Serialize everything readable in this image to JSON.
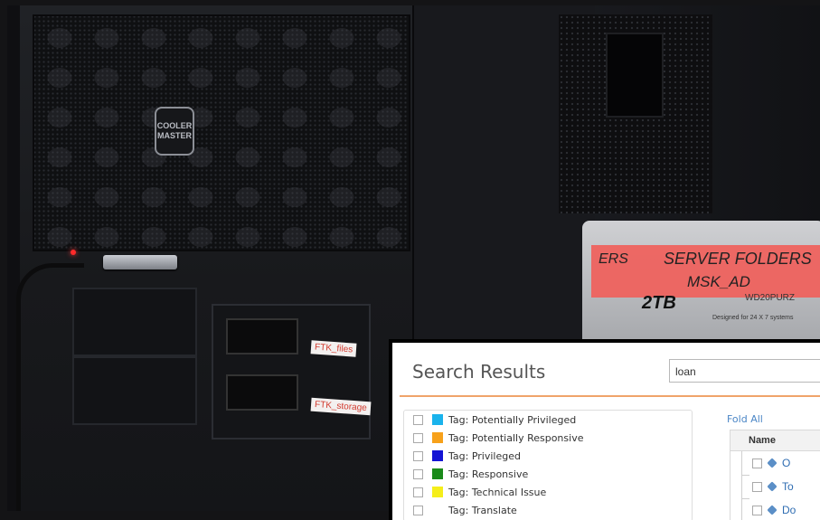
{
  "photo": {
    "case_logo": [
      "COOLER",
      "MASTER"
    ],
    "stickers": [
      "FTK_files",
      "FTK_storage"
    ],
    "hdd": {
      "tape_prefix": "ERS",
      "tape_line1": "SERVER FOLDERS",
      "tape_line2": "MSK_AD",
      "capacity": "2TB",
      "model": "WD20PURZ",
      "badge": "Designed for 24 X 7 systems"
    }
  },
  "panel": {
    "title": "Search Results",
    "search_value": "loan",
    "fold_all": "Fold All",
    "grid_header": "Name",
    "tags": [
      {
        "label": "Tag: Potentially Privileged",
        "color": "#1ab3ec"
      },
      {
        "label": "Tag: Potentially Responsive",
        "color": "#f7a11a"
      },
      {
        "label": "Tag: Privileged",
        "color": "#1414d4"
      },
      {
        "label": "Tag: Responsive",
        "color": "#1a8a1a"
      },
      {
        "label": "Tag: Technical Issue",
        "color": "#f5ee1a"
      },
      {
        "label": "Tag: Translate",
        "color": "#ffffff"
      }
    ],
    "rows": [
      {
        "text": "O"
      },
      {
        "text": "To"
      },
      {
        "text": "Do"
      }
    ]
  }
}
